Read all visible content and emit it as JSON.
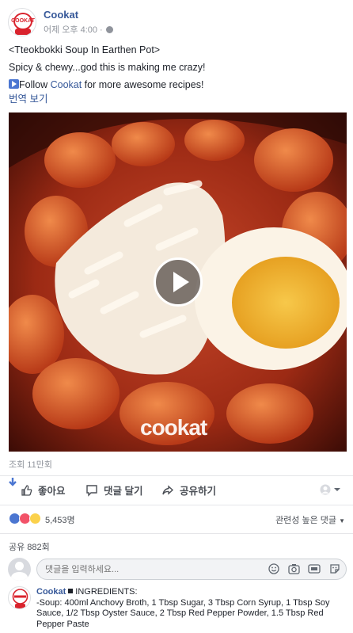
{
  "post": {
    "page_name": "Cookat",
    "timestamp": "어제 오후 4:00 · ",
    "avatar_logo": "COOKAT",
    "line1": "<Tteokbokki Soup In Earthen Pot>",
    "line2": "Spicy & chewy...god this is making me crazy!",
    "line3_prefix": "Follow ",
    "line3_link": "Cookat",
    "line3_suffix": " for more awesome recipes!",
    "translate": "번역 보기"
  },
  "video": {
    "watermark": "cookat"
  },
  "stats": {
    "views": "조회 11만회",
    "reaction_count": "5,453명",
    "sort_label": "관련성 높은 댓글",
    "shares": "공유 882회"
  },
  "actions": {
    "like": "좋아요",
    "comment": "댓글 달기",
    "share": "공유하기"
  },
  "comment_box": {
    "placeholder": "댓글을 입력하세요..."
  },
  "comment": {
    "author": "Cookat",
    "text": "INGREDIENTS:\n-Soup: 400ml Anchovy Broth, 1 Tbsp Sugar, 3 Tbsp Corn Syrup, 1 Tbsp Soy Sauce, 1/2 Tbsp Oyster Sauce, 2 Tbsp Red Pepper Powder, 1.5 Tbsp Red Pepper Paste"
  },
  "colors": {
    "link": "#365899",
    "like_blue": "#4b76d1",
    "love_red": "#f25268",
    "wow_yellow": "#fbd14b",
    "brand_red": "#d9232d"
  },
  "icons": {
    "globe": "globe-icon",
    "like": "thumbs-up-icon",
    "comment": "speech-bubble-icon",
    "share": "share-arrow-icon",
    "play": "play-icon"
  }
}
